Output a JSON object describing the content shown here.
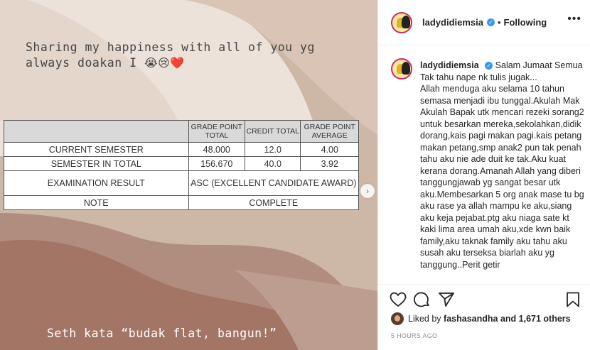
{
  "story": {
    "caption_line1": "Sharing my happiness with all of you yg",
    "caption_line2": "always doakan I",
    "caption_emojis": "😭😢❤️",
    "footer_text": "Seth kata “budak flat, bangun!”",
    "table": {
      "headers": [
        "",
        "GRADE POINT TOTAL",
        "CREDIT TOTAL",
        "GRADE POINT AVERAGE"
      ],
      "rows": [
        {
          "label": "CURRENT SEMESTER",
          "gpt": "48.000",
          "credit": "12.0",
          "gpa": "4.00"
        },
        {
          "label": "SEMESTER IN TOTAL",
          "gpt": "156.670",
          "credit": "40.0",
          "gpa": "3.92"
        }
      ],
      "exam_label": "EXAMINATION RESULT",
      "exam_value": "ASC (EXCELLENT CANDIDATE AWARD)",
      "note_label": "NOTE",
      "note_value": "COMPLETE"
    },
    "colors": {
      "bg_light": "#e9dcd3",
      "bg_mid": "#cdb7a7",
      "bg_dark": "#a07466",
      "bg_dark2": "#b89588"
    }
  },
  "post": {
    "username": "ladydidiemsia",
    "separator": "•",
    "follow_status": "Following",
    "more_icon": "more-icon",
    "comment_username": "ladydidiemsia",
    "comment_text": "Salam Jumaat Semua\nTak tahu nape nk tulis jugak...\nAllah menduga aku selama 10 tahun semasa menjadi ibu tunggal.Akulah Mak Akulah Bapak utk mencari rezeki sorang2 untuk besarkan mereka,sekolahkan,didik dorang,kais pagi makan pagi.kais petang makan petang,smp anak2 pun tak penah tahu aku nie ade duit ke tak.Aku kuat kerana dorang.Amanah Allah yang diberi tanggungjawab yg sangat besar utk aku.Membesarkan 5 org anak mase tu bg aku rase ya allah mampu ke aku,siang aku keja pejabat.ptg aku niaga sate kt kaki lima area umah aku,xde kwn baik family,aku taknak family aku tahu aku susah aku terseksa biarlah aku yg tanggung..Perit getir",
    "likes_prefix": "Liked by",
    "liker": "fashasandha",
    "likes_suffix": "and 1,671 others",
    "time": "5 HOURS AGO"
  }
}
